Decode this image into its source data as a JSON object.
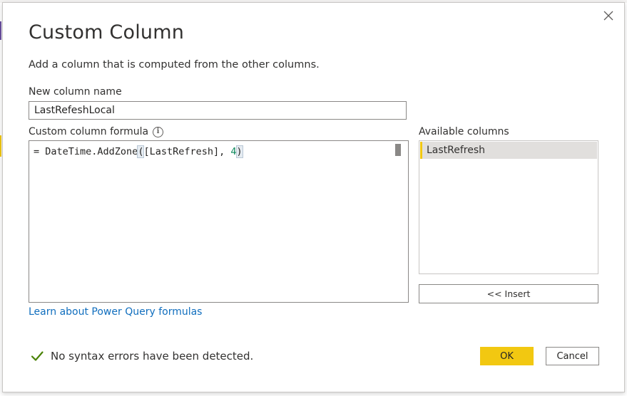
{
  "dialog": {
    "title": "Custom Column",
    "subtitle": "Add a column that is computed from the other columns.",
    "close_icon": "close-icon"
  },
  "new_column": {
    "label": "New column name",
    "value": "LastRefeshLocal"
  },
  "formula": {
    "label": "Custom column formula",
    "info_icon": "info-icon",
    "prefix": "= DateTime.AddZone",
    "open_paren": "(",
    "argument": "[LastRefresh], ",
    "number": "4",
    "close_paren": ")"
  },
  "learn_link": "Learn about Power Query formulas",
  "available_columns": {
    "label": "Available columns",
    "items": [
      "LastRefresh"
    ],
    "insert_label": "<< Insert"
  },
  "status": {
    "icon": "check-icon",
    "text": "No syntax errors have been detected."
  },
  "buttons": {
    "ok": "OK",
    "cancel": "Cancel"
  },
  "colors": {
    "accent": "#f2c811",
    "link": "#106ebe",
    "success": "#498205"
  }
}
